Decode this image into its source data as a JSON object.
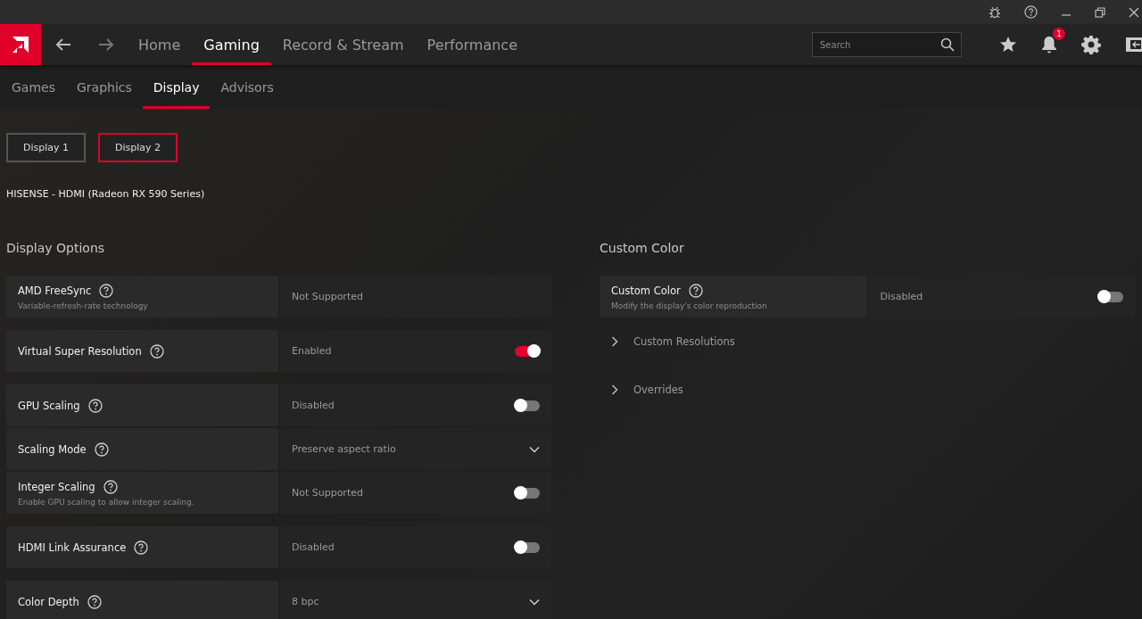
{
  "nav": {
    "tabs": [
      {
        "label": "Home",
        "selected": false
      },
      {
        "label": "Gaming",
        "selected": true
      },
      {
        "label": "Record & Stream",
        "selected": false
      },
      {
        "label": "Performance",
        "selected": false
      }
    ],
    "search": {
      "placeholder": "Search"
    },
    "notifications": {
      "badge": "1"
    }
  },
  "subtabs": [
    {
      "label": "Games",
      "selected": false
    },
    {
      "label": "Graphics",
      "selected": false
    },
    {
      "label": "Display",
      "selected": true
    },
    {
      "label": "Advisors",
      "selected": false
    }
  ],
  "displays": [
    {
      "label": "Display 1",
      "selected": false
    },
    {
      "label": "Display 2",
      "selected": true
    }
  ],
  "device": "HISENSE - HDMI (Radeon RX 590 Series)",
  "display_options": {
    "title": "Display Options",
    "groups": [
      [
        {
          "label": "AMD FreeSync",
          "description": "Variable-refresh-rate technology",
          "value": "Not Supported",
          "kind": "text"
        }
      ],
      [
        {
          "label": "Virtual Super Resolution",
          "value": "Enabled",
          "kind": "toggle",
          "on": true
        }
      ],
      [
        {
          "label": "GPU Scaling",
          "value": "Disabled",
          "kind": "toggle",
          "on": false
        },
        {
          "label": "Scaling Mode",
          "value": "Preserve aspect ratio",
          "kind": "dropdown"
        },
        {
          "label": "Integer Scaling",
          "description": "Enable GPU scaling to allow integer scaling.",
          "value": "Not Supported",
          "kind": "toggle",
          "on": false
        }
      ],
      [
        {
          "label": "HDMI Link Assurance",
          "value": "Disabled",
          "kind": "toggle",
          "on": false
        }
      ],
      [
        {
          "label": "Color Depth",
          "value": "8 bpc",
          "kind": "dropdown"
        }
      ]
    ]
  },
  "custom_color": {
    "title": "Custom Color",
    "setting": {
      "label": "Custom Color",
      "description": "Modify the display's color reproduction",
      "value": "Disabled",
      "kind": "toggle",
      "on": false
    },
    "sections": [
      {
        "label": "Custom Resolutions",
        "expanded": false
      },
      {
        "label": "Overrides",
        "expanded": false
      }
    ]
  }
}
